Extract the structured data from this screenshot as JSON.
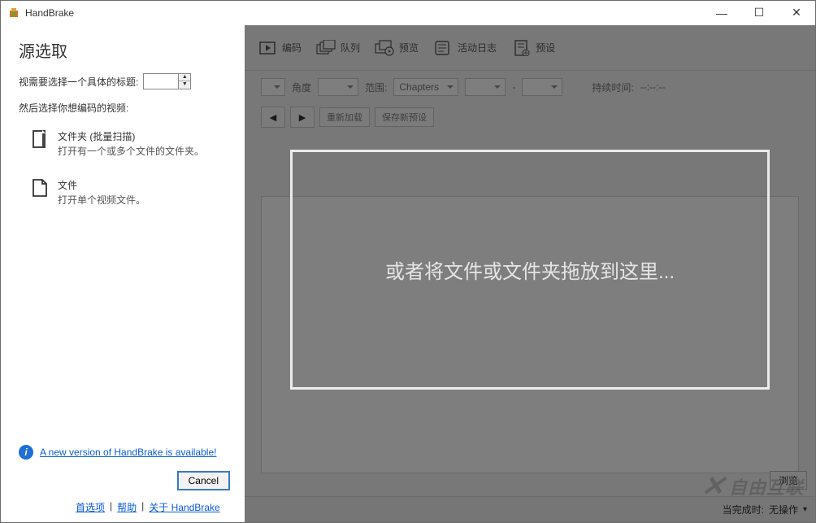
{
  "app": {
    "title": "HandBrake"
  },
  "win": {
    "min": "—",
    "max": "☐",
    "close": "✕"
  },
  "toolbar": {
    "encode": "编码",
    "queue": "队列",
    "preview": "预览",
    "log": "活动日志",
    "preset": "预设"
  },
  "opts": {
    "angle": "角度",
    "range": "范围:",
    "chapters": "Chapters",
    "dash": "-",
    "duration_label": "持续时间:",
    "duration_value": "--:--:--"
  },
  "btns": {
    "play": "▶",
    "reload": "重新加载",
    "save_preset": "保存新预设"
  },
  "browse": "浏览",
  "status": {
    "label": "当完成时:",
    "value": "无操作",
    "chev": "▾"
  },
  "watermark": "自由互联",
  "drop": "或者将文件或文件夹拖放到这里...",
  "panel": {
    "heading": "源选取",
    "title_label": "视需要选择一个具体的标题:",
    "then_label": "然后选择你想编码的视频:",
    "folder_title": "文件夹 (批量扫描)",
    "folder_desc": "打开有一个或多个文件的文件夹。",
    "file_title": "文件",
    "file_desc": "打开单个视频文件。",
    "alert": "A new version of HandBrake is available!",
    "cancel": "Cancel",
    "links": {
      "prefs": "首选项",
      "help": "帮助",
      "about": "关于 HandBrake"
    }
  }
}
